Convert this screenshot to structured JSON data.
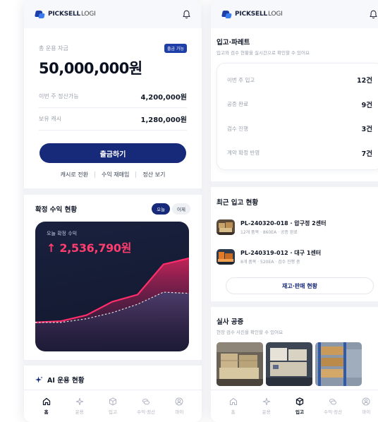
{
  "brand": {
    "name": "PICKSELL",
    "suffix": "LOGI"
  },
  "colors": {
    "primary": "#172a7a",
    "accent": "#ff3d6e",
    "chart_bg": "#151b33",
    "muted": "#9aa0ad"
  },
  "left": {
    "assets": {
      "label": "총 운용 자금",
      "badge": "출금 가능",
      "amount": "50,000,000원",
      "settle_label": "이번 주 정산가능",
      "settle_value": "4,200,000원",
      "cash_label": "보유 캐시",
      "cash_value": "1,280,000원",
      "withdraw_button": "출금하기",
      "links": [
        "캐시로 전환",
        "수익 재매입",
        "정산 보기"
      ]
    },
    "profit": {
      "title": "확정 수익 현황",
      "tabs": [
        "오늘",
        "어제"
      ],
      "card_label": "오늘 확정 수익",
      "card_value": "↑ 2,536,790원"
    },
    "ai": {
      "title": "AI 운용 현황"
    }
  },
  "right": {
    "inbound": {
      "title": "입고·파레트",
      "subtitle": "입고와 검수 현황을 실시간으로 확인할 수 있어요",
      "stats": [
        {
          "label": "이번 주 입고",
          "value": "12건"
        },
        {
          "label": "공증 완료",
          "value": "9건"
        },
        {
          "label": "검수 진행",
          "value": "3건"
        },
        {
          "label": "계약 확정 반영",
          "value": "7건"
        }
      ]
    },
    "recent": {
      "title": "최근 입고 현황",
      "items": [
        {
          "name": "PL-240320-018 · 압구정 2센터",
          "meta": "12개 품목 · 860EA · 공증 완료"
        },
        {
          "name": "PL-240319-012 · 대구 1센터",
          "meta": "8개 품목 · 520EA · 검수 진행 중"
        }
      ],
      "button": "재고·판매 현황"
    },
    "photos": {
      "title": "실사 공증",
      "subtitle": "현장 검수 사진을 확인할 수 있어요"
    }
  },
  "tabbar": {
    "tabs": [
      {
        "label": "홈",
        "icon": "home-icon"
      },
      {
        "label": "운용",
        "icon": "sparkle-icon"
      },
      {
        "label": "입고",
        "icon": "box-icon"
      },
      {
        "label": "수익·정산",
        "icon": "coins-icon"
      },
      {
        "label": "마이",
        "icon": "user-icon"
      }
    ],
    "left_active": "홈",
    "right_active": "입고"
  },
  "chart_data": {
    "type": "area",
    "title": "",
    "series": [
      {
        "values": [
          10,
          11,
          16,
          27,
          33,
          58,
          63
        ]
      },
      {
        "values": [
          10,
          10,
          13,
          18,
          25,
          35,
          34
        ]
      }
    ]
  }
}
